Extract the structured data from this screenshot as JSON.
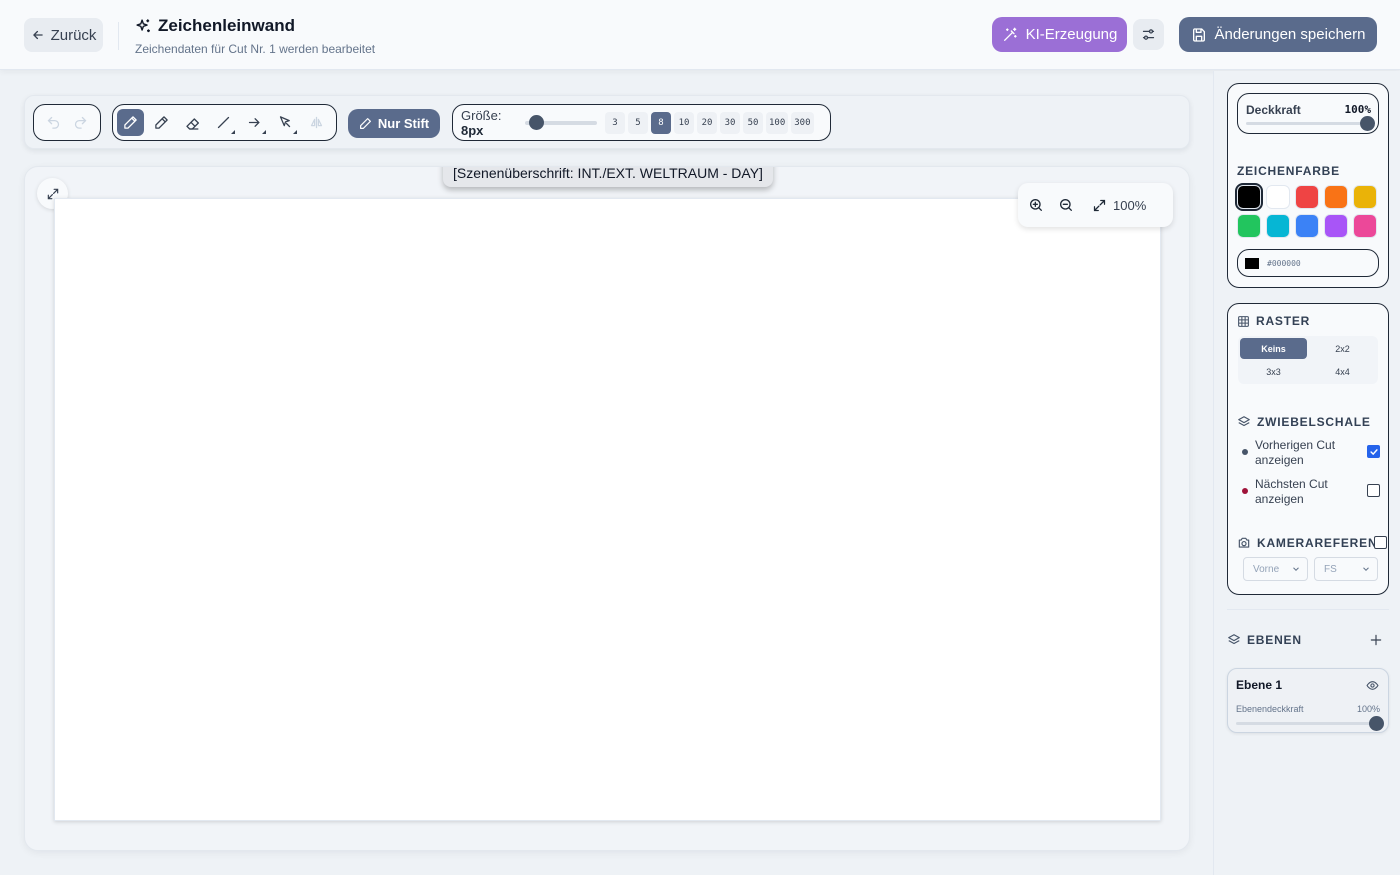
{
  "header": {
    "back_label": "Zurück",
    "title": "Zeichenleinwand",
    "subtitle": "Zeichendaten für Cut Nr. 1 werden bearbeitet",
    "ai_label": "KI-Erzeugung",
    "save_label": "Änderungen speichern"
  },
  "toolbar": {
    "pen_only_label": "Nur Stift",
    "size_label": "Größe:",
    "size_value": "8px",
    "size_fraction": 0.08,
    "presets": [
      "3",
      "5",
      "8",
      "10",
      "20",
      "30",
      "50",
      "100",
      "300"
    ],
    "active_preset": "8"
  },
  "canvas": {
    "scene_heading": "[Szenenüberschrift: INT./EXT. WELTRAUM - DAY]",
    "zoom_value": "100%"
  },
  "panel": {
    "opacity_label": "Deckkraft",
    "opacity_value": "100%",
    "color_title": "ZEICHENFARBE",
    "colors": [
      "#000000",
      "#ffffff",
      "#ef4444",
      "#f97316",
      "#eab308",
      "#22c55e",
      "#06b6d4",
      "#3b82f6",
      "#a855f7",
      "#ec4899"
    ],
    "hex_value": "#000000",
    "grid_title": "RASTER",
    "grid_options": [
      "Keins",
      "2x2",
      "3x3",
      "4x4"
    ],
    "onion_title": "ZWIEBELSCHALE",
    "onion_prev_label": "Vorherigen Cut anzeigen",
    "onion_next_label": "Nächsten Cut anzeigen",
    "onion_prev_color": "#475569",
    "onion_next_color": "#9f1239",
    "camera_title": "KAMERAREFERENZ",
    "camera_view": "Vorne",
    "camera_shot": "FS",
    "layers_title": "EBENEN",
    "layer_name": "Ebene 1",
    "layer_opacity_label": "Ebenendeckkraft",
    "layer_opacity_value": "100%"
  }
}
